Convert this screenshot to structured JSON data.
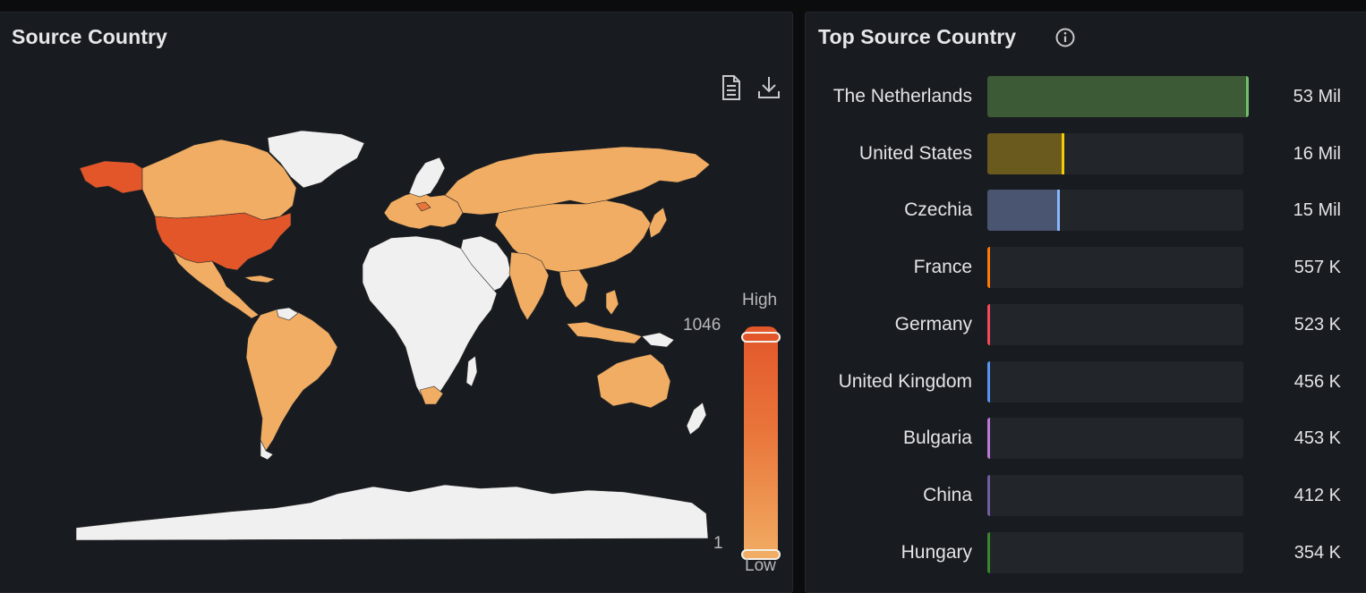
{
  "map_panel": {
    "title": "Source Country",
    "icons": [
      "document-icon",
      "download-icon"
    ],
    "legend": {
      "high_label": "High",
      "low_label": "Low",
      "max_value": "1046",
      "min_value": "1"
    },
    "colors": {
      "high": "#e3562a",
      "mid": "#e9753b",
      "low": "#f1ad63",
      "no_data": "#f0f0f0"
    }
  },
  "bar_panel": {
    "title": "Top Source Country",
    "info_icon": "info-circle-icon",
    "rows": [
      {
        "label": "The Netherlands",
        "value": "53 Mil",
        "fraction": 1.0,
        "color": "#73bf69",
        "fill": "#3d5a36"
      },
      {
        "label": "United States",
        "value": "16 Mil",
        "fraction": 0.302,
        "color": "#f2cc0c",
        "fill": "#6a5a1e"
      },
      {
        "label": "Czechia",
        "value": "15 Mil",
        "fraction": 0.283,
        "color": "#8ab8ff",
        "fill": "#4a5571"
      },
      {
        "label": "France",
        "value": "557 K",
        "fraction": 0.0105,
        "color": "#ff780a",
        "fill": "#ff780a"
      },
      {
        "label": "Germany",
        "value": "523 K",
        "fraction": 0.0099,
        "color": "#f2495c",
        "fill": "#f2495c"
      },
      {
        "label": "United Kingdom",
        "value": "456 K",
        "fraction": 0.0086,
        "color": "#5794f2",
        "fill": "#5794f2"
      },
      {
        "label": "Bulgaria",
        "value": "453 K",
        "fraction": 0.0085,
        "color": "#b877d9",
        "fill": "#b877d9"
      },
      {
        "label": "China",
        "value": "412 K",
        "fraction": 0.0078,
        "color": "#705da0",
        "fill": "#705da0"
      },
      {
        "label": "Hungary",
        "value": "354 K",
        "fraction": 0.0067,
        "color": "#37872d",
        "fill": "#37872d"
      }
    ]
  }
}
